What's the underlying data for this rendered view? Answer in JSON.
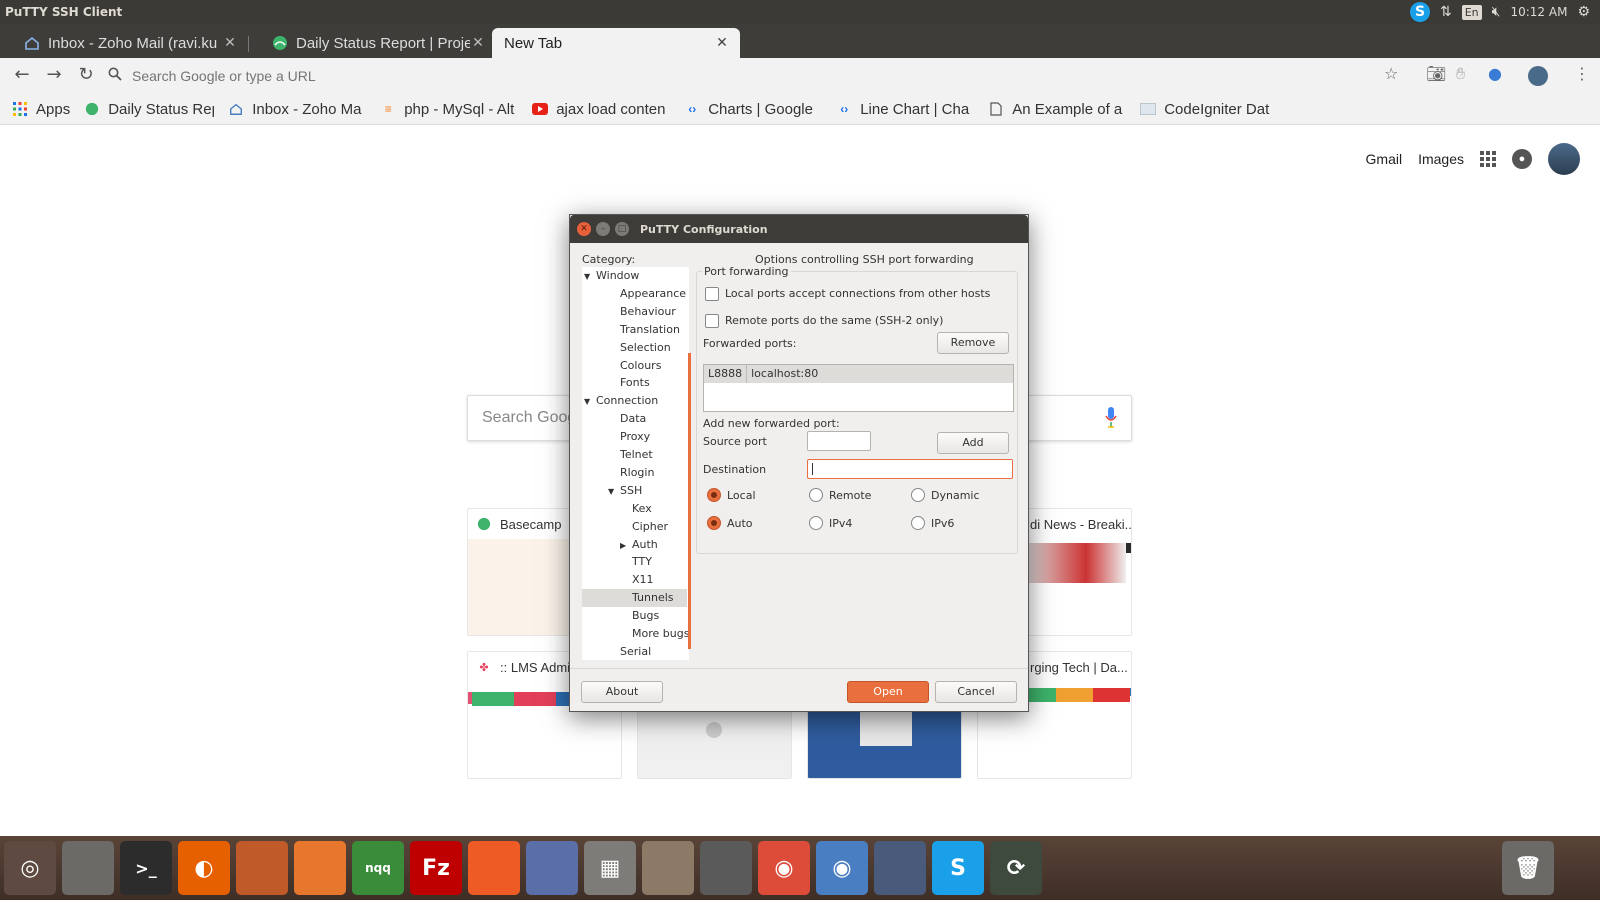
{
  "system_bar": {
    "title": "PuTTY SSH Client",
    "lang": "En",
    "time": "10:12 AM",
    "skype_glyph": "S"
  },
  "tabs": [
    {
      "title": "Inbox - Zoho Mail (ravi.ku",
      "icon": "zoho-mail-icon",
      "color": "#4a7ec2"
    },
    {
      "title": "Daily Status Report | Proje",
      "icon": "basecamp-icon",
      "color": "#3db36b"
    },
    {
      "title": "New Tab",
      "icon": "",
      "color": ""
    }
  ],
  "omnibox": {
    "placeholder": "Search Google or type a URL"
  },
  "bookmarks": [
    {
      "label": "Apps",
      "icon": "apps-grid-icon"
    },
    {
      "label": "Daily Status Rep",
      "icon": "basecamp-icon"
    },
    {
      "label": "Inbox - Zoho Ma",
      "icon": "zoho-mail-icon"
    },
    {
      "label": "php - MySql - Alt",
      "icon": "stackoverflow-icon"
    },
    {
      "label": "ajax load conten",
      "icon": "youtube-icon"
    },
    {
      "label": "Charts | Google",
      "icon": "code-icon"
    },
    {
      "label": "Line Chart | Cha",
      "icon": "code-icon"
    },
    {
      "label": "An Example of a",
      "icon": "document-icon"
    },
    {
      "label": "CodeIgniter Dat",
      "icon": "webpage-icon"
    }
  ],
  "google": {
    "gmail": "Gmail",
    "images": "Images",
    "search_placeholder": "Search Goog"
  },
  "tiles": [
    {
      "title": "Basecamp"
    },
    {
      "title": "di News - Breaki..."
    },
    {
      "title": ":: LMS Admin"
    },
    {
      "title": "rging Tech | Da..."
    }
  ],
  "putty": {
    "title": "PuTTY Configuration",
    "category_label": "Category:",
    "header": "Options controlling SSH port forwarding",
    "tree": [
      {
        "label": "Window",
        "level": 0,
        "expander": "▼"
      },
      {
        "label": "Appearance",
        "level": 1,
        "expander": ""
      },
      {
        "label": "Behaviour",
        "level": 1,
        "expander": ""
      },
      {
        "label": "Translation",
        "level": 1,
        "expander": ""
      },
      {
        "label": "Selection",
        "level": 1,
        "expander": ""
      },
      {
        "label": "Colours",
        "level": 1,
        "expander": ""
      },
      {
        "label": "Fonts",
        "level": 1,
        "expander": ""
      },
      {
        "label": "Connection",
        "level": 0,
        "expander": "▼"
      },
      {
        "label": "Data",
        "level": 1,
        "expander": ""
      },
      {
        "label": "Proxy",
        "level": 1,
        "expander": ""
      },
      {
        "label": "Telnet",
        "level": 1,
        "expander": ""
      },
      {
        "label": "Rlogin",
        "level": 1,
        "expander": ""
      },
      {
        "label": "SSH",
        "level": 1,
        "expander": "▼"
      },
      {
        "label": "Kex",
        "level": 2,
        "expander": ""
      },
      {
        "label": "Cipher",
        "level": 2,
        "expander": ""
      },
      {
        "label": "Auth",
        "level": 2,
        "expander": "▶"
      },
      {
        "label": "TTY",
        "level": 2,
        "expander": ""
      },
      {
        "label": "X11",
        "level": 2,
        "expander": ""
      },
      {
        "label": "Tunnels",
        "level": 2,
        "expander": "",
        "selected": true
      },
      {
        "label": "Bugs",
        "level": 2,
        "expander": ""
      },
      {
        "label": "More bugs",
        "level": 2,
        "expander": ""
      },
      {
        "label": "Serial",
        "level": 1,
        "expander": ""
      }
    ],
    "port_forwarding": {
      "legend": "Port forwarding",
      "local_accept_label": "Local ports accept connections from other hosts",
      "local_accept_checked": false,
      "remote_same_label": "Remote ports do the same (SSH-2 only)",
      "remote_same_checked": false,
      "forwarded_ports_label": "Forwarded ports:",
      "remove_label": "Remove",
      "forwarded": [
        {
          "source": "L8888",
          "dest": "localhost:80"
        }
      ],
      "add_new_label": "Add new forwarded port:",
      "source_port_label": "Source port",
      "source_port_value": "",
      "add_label": "Add",
      "destination_label": "Destination",
      "destination_value": "",
      "direction": {
        "options": [
          "Local",
          "Remote",
          "Dynamic"
        ],
        "selected": "Local"
      },
      "protocol": {
        "options": [
          "Auto",
          "IPv4",
          "IPv6"
        ],
        "selected": "Auto"
      }
    },
    "buttons": {
      "about": "About",
      "open": "Open",
      "cancel": "Cancel"
    }
  },
  "dock": [
    {
      "name": "ubuntu-dash-icon",
      "color": "#5e4a40"
    },
    {
      "name": "files-icon",
      "color": "#6b6a66"
    },
    {
      "name": "terminal-icon",
      "color": "#2c2c2c"
    },
    {
      "name": "firefox-icon",
      "color": "#e66000"
    },
    {
      "name": "libreoffice-impress-icon",
      "color": "#c05a28"
    },
    {
      "name": "software-center-icon",
      "color": "#e8772e"
    },
    {
      "name": "nqq-editor-icon",
      "color": "#3a8c3a"
    },
    {
      "name": "filezilla-icon",
      "color": "#bf0000"
    },
    {
      "name": "postman-icon",
      "color": "#ef5b25"
    },
    {
      "name": "putty-icon",
      "color": "#5a6ea8"
    },
    {
      "name": "calculator-icon",
      "color": "#7d7c78"
    },
    {
      "name": "text-editor-icon",
      "color": "#8c7a66"
    },
    {
      "name": "inkscape-icon",
      "color": "#5a5a5a"
    },
    {
      "name": "chrome-icon",
      "color": "#dd4b39"
    },
    {
      "name": "chromium-icon",
      "color": "#4a7ec2"
    },
    {
      "name": "screenshot-icon",
      "color": "#4a5a7a"
    },
    {
      "name": "skype-icon",
      "color": "#1aa0e8"
    },
    {
      "name": "update-manager-icon",
      "color": "#3e4a3e"
    },
    {
      "name": "trash-icon",
      "color": "#6b6a66"
    }
  ],
  "dock_labels": {
    "nqq": "nqq",
    "skype": "S",
    "filezilla": "Fz"
  }
}
